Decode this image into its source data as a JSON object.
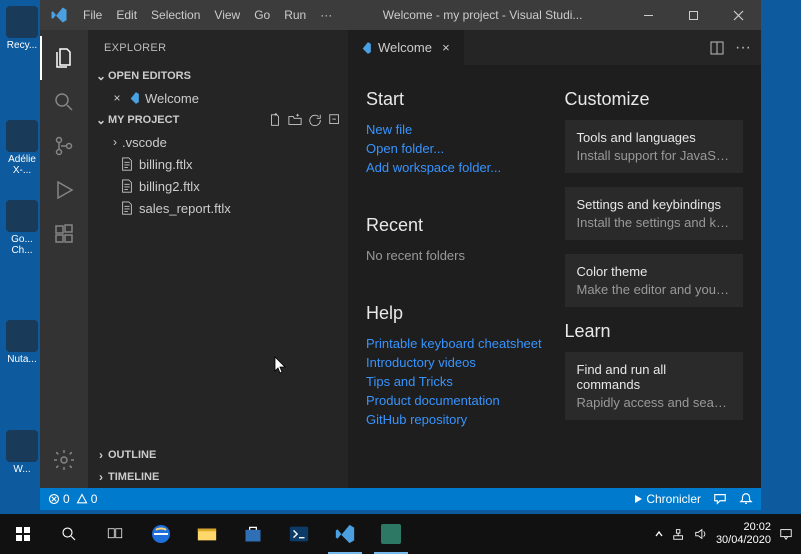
{
  "window": {
    "title": "Welcome - my project - Visual Studi..."
  },
  "menu": [
    "File",
    "Edit",
    "Selection",
    "View",
    "Go",
    "Run",
    "···"
  ],
  "sidebar": {
    "title": "EXPLORER",
    "openEditors": {
      "label": "OPEN EDITORS",
      "items": [
        {
          "label": "Welcome"
        }
      ]
    },
    "project": {
      "label": "MY PROJECT",
      "items": [
        {
          "label": ".vscode",
          "kind": "folder"
        },
        {
          "label": "billing.ftlx",
          "kind": "file"
        },
        {
          "label": "billing2.ftlx",
          "kind": "file"
        },
        {
          "label": "sales_report.ftlx",
          "kind": "file"
        }
      ]
    },
    "outline": "OUTLINE",
    "timeline": "TIMELINE"
  },
  "tab": {
    "label": "Welcome"
  },
  "welcome": {
    "start": {
      "heading": "Start",
      "links": [
        "New file",
        "Open folder...",
        "Add workspace folder..."
      ]
    },
    "recent": {
      "heading": "Recent",
      "empty": "No recent folders"
    },
    "help": {
      "heading": "Help",
      "links": [
        "Printable keyboard cheatsheet",
        "Introductory videos",
        "Tips and Tricks",
        "Product documentation",
        "GitHub repository"
      ]
    },
    "customize": {
      "heading": "Customize",
      "cards": [
        {
          "title": "Tools and languages",
          "desc": "Install support for JavaScri..."
        },
        {
          "title": "Settings and keybindings",
          "desc": "Install the settings and key..."
        },
        {
          "title": "Color theme",
          "desc": "Make the editor and your ..."
        }
      ]
    },
    "learn": {
      "heading": "Learn",
      "cards": [
        {
          "title": "Find and run all commands",
          "desc": "Rapidly access and search ..."
        }
      ]
    }
  },
  "statusbar": {
    "errors": "0",
    "warnings": "0",
    "chronicler": "Chronicler"
  },
  "desktopIcons": [
    "Recy...",
    "Adélie X-...",
    "Go... Ch...",
    "Nuta...",
    "W..."
  ],
  "taskbar": {
    "time": "20:02",
    "date": "30/04/2020"
  }
}
